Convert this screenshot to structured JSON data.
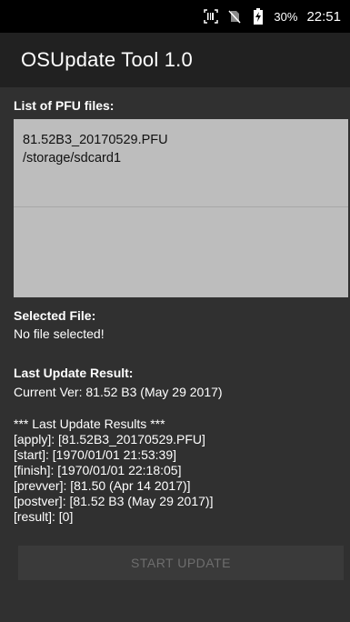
{
  "status_bar": {
    "battery_percent": "30%",
    "time": "22:51",
    "icons": [
      "barcode-scanner-icon",
      "no-sim-icon",
      "battery-charging-icon"
    ]
  },
  "app_bar": {
    "title": "OSUpdate Tool 1.0"
  },
  "main": {
    "list_label": "List of PFU files:",
    "files": [
      {
        "name": "81.52B3_20170529.PFU",
        "path": "/storage/sdcard1"
      }
    ],
    "selected_label": "Selected File:",
    "selected_value": "No file selected!",
    "last_result_label": "Last Update Result:",
    "current_version": "Current Ver: 81.52 B3 (May 29 2017)",
    "results": {
      "header": "*** Last Update Results ***",
      "apply": "[apply]: [81.52B3_20170529.PFU]",
      "start": "[start]: [1970/01/01 21:53:39]",
      "finish": "[finish]: [1970/01/01 22:18:05]",
      "prevver": "[prevver]: [81.50 (Apr 14 2017)]",
      "postver": "[postver]: [81.52 B3 (May 29 2017)]",
      "result": "[result]: [0]"
    },
    "start_button_label": "START UPDATE"
  }
}
